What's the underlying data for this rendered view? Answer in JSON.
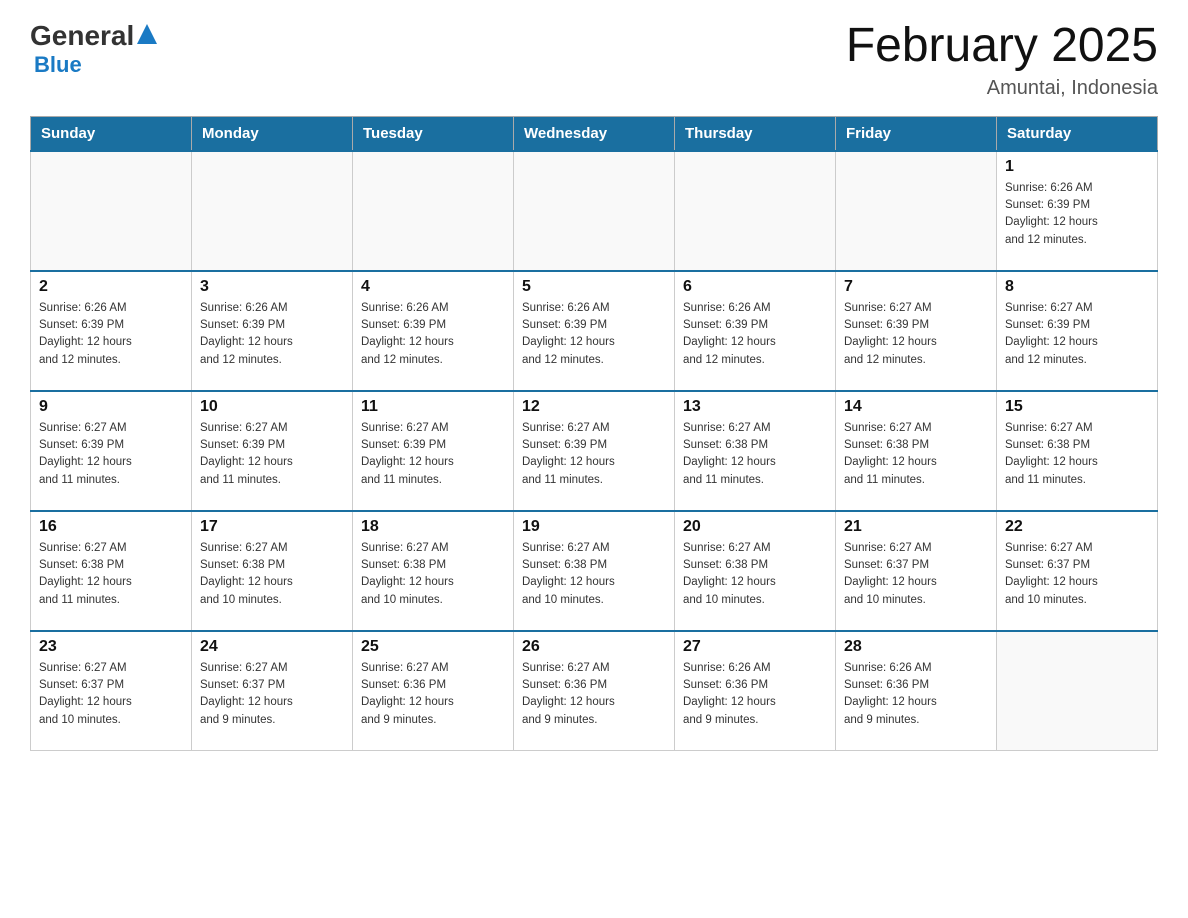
{
  "header": {
    "logo_general": "General",
    "logo_blue": "Blue",
    "title": "February 2025",
    "location": "Amuntai, Indonesia"
  },
  "days_of_week": [
    "Sunday",
    "Monday",
    "Tuesday",
    "Wednesday",
    "Thursday",
    "Friday",
    "Saturday"
  ],
  "weeks": [
    {
      "days": [
        {
          "number": "",
          "info": ""
        },
        {
          "number": "",
          "info": ""
        },
        {
          "number": "",
          "info": ""
        },
        {
          "number": "",
          "info": ""
        },
        {
          "number": "",
          "info": ""
        },
        {
          "number": "",
          "info": ""
        },
        {
          "number": "1",
          "info": "Sunrise: 6:26 AM\nSunset: 6:39 PM\nDaylight: 12 hours\nand 12 minutes."
        }
      ]
    },
    {
      "days": [
        {
          "number": "2",
          "info": "Sunrise: 6:26 AM\nSunset: 6:39 PM\nDaylight: 12 hours\nand 12 minutes."
        },
        {
          "number": "3",
          "info": "Sunrise: 6:26 AM\nSunset: 6:39 PM\nDaylight: 12 hours\nand 12 minutes."
        },
        {
          "number": "4",
          "info": "Sunrise: 6:26 AM\nSunset: 6:39 PM\nDaylight: 12 hours\nand 12 minutes."
        },
        {
          "number": "5",
          "info": "Sunrise: 6:26 AM\nSunset: 6:39 PM\nDaylight: 12 hours\nand 12 minutes."
        },
        {
          "number": "6",
          "info": "Sunrise: 6:26 AM\nSunset: 6:39 PM\nDaylight: 12 hours\nand 12 minutes."
        },
        {
          "number": "7",
          "info": "Sunrise: 6:27 AM\nSunset: 6:39 PM\nDaylight: 12 hours\nand 12 minutes."
        },
        {
          "number": "8",
          "info": "Sunrise: 6:27 AM\nSunset: 6:39 PM\nDaylight: 12 hours\nand 12 minutes."
        }
      ]
    },
    {
      "days": [
        {
          "number": "9",
          "info": "Sunrise: 6:27 AM\nSunset: 6:39 PM\nDaylight: 12 hours\nand 11 minutes."
        },
        {
          "number": "10",
          "info": "Sunrise: 6:27 AM\nSunset: 6:39 PM\nDaylight: 12 hours\nand 11 minutes."
        },
        {
          "number": "11",
          "info": "Sunrise: 6:27 AM\nSunset: 6:39 PM\nDaylight: 12 hours\nand 11 minutes."
        },
        {
          "number": "12",
          "info": "Sunrise: 6:27 AM\nSunset: 6:39 PM\nDaylight: 12 hours\nand 11 minutes."
        },
        {
          "number": "13",
          "info": "Sunrise: 6:27 AM\nSunset: 6:38 PM\nDaylight: 12 hours\nand 11 minutes."
        },
        {
          "number": "14",
          "info": "Sunrise: 6:27 AM\nSunset: 6:38 PM\nDaylight: 12 hours\nand 11 minutes."
        },
        {
          "number": "15",
          "info": "Sunrise: 6:27 AM\nSunset: 6:38 PM\nDaylight: 12 hours\nand 11 minutes."
        }
      ]
    },
    {
      "days": [
        {
          "number": "16",
          "info": "Sunrise: 6:27 AM\nSunset: 6:38 PM\nDaylight: 12 hours\nand 11 minutes."
        },
        {
          "number": "17",
          "info": "Sunrise: 6:27 AM\nSunset: 6:38 PM\nDaylight: 12 hours\nand 10 minutes."
        },
        {
          "number": "18",
          "info": "Sunrise: 6:27 AM\nSunset: 6:38 PM\nDaylight: 12 hours\nand 10 minutes."
        },
        {
          "number": "19",
          "info": "Sunrise: 6:27 AM\nSunset: 6:38 PM\nDaylight: 12 hours\nand 10 minutes."
        },
        {
          "number": "20",
          "info": "Sunrise: 6:27 AM\nSunset: 6:38 PM\nDaylight: 12 hours\nand 10 minutes."
        },
        {
          "number": "21",
          "info": "Sunrise: 6:27 AM\nSunset: 6:37 PM\nDaylight: 12 hours\nand 10 minutes."
        },
        {
          "number": "22",
          "info": "Sunrise: 6:27 AM\nSunset: 6:37 PM\nDaylight: 12 hours\nand 10 minutes."
        }
      ]
    },
    {
      "days": [
        {
          "number": "23",
          "info": "Sunrise: 6:27 AM\nSunset: 6:37 PM\nDaylight: 12 hours\nand 10 minutes."
        },
        {
          "number": "24",
          "info": "Sunrise: 6:27 AM\nSunset: 6:37 PM\nDaylight: 12 hours\nand 9 minutes."
        },
        {
          "number": "25",
          "info": "Sunrise: 6:27 AM\nSunset: 6:36 PM\nDaylight: 12 hours\nand 9 minutes."
        },
        {
          "number": "26",
          "info": "Sunrise: 6:27 AM\nSunset: 6:36 PM\nDaylight: 12 hours\nand 9 minutes."
        },
        {
          "number": "27",
          "info": "Sunrise: 6:26 AM\nSunset: 6:36 PM\nDaylight: 12 hours\nand 9 minutes."
        },
        {
          "number": "28",
          "info": "Sunrise: 6:26 AM\nSunset: 6:36 PM\nDaylight: 12 hours\nand 9 minutes."
        },
        {
          "number": "",
          "info": ""
        }
      ]
    }
  ]
}
